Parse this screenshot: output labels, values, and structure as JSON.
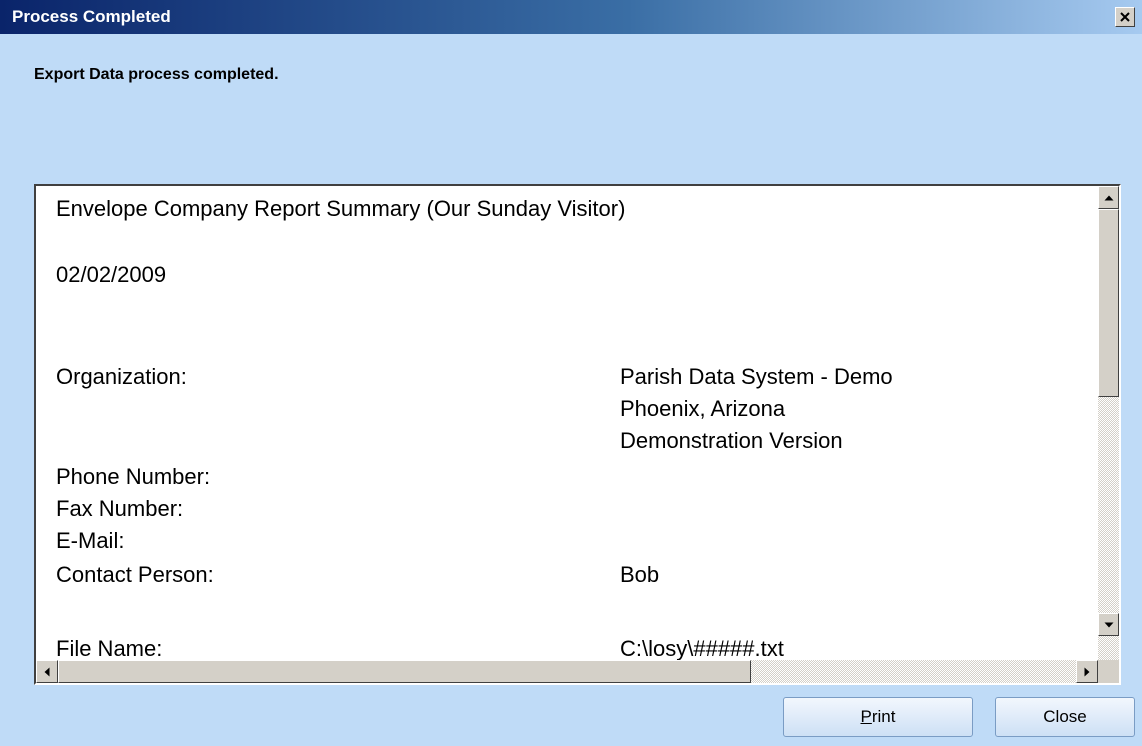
{
  "window": {
    "title": "Process Completed",
    "close_glyph": "X"
  },
  "message": "Export Data process completed.",
  "report": {
    "title": "Envelope Company Report Summary (Our Sunday Visitor)",
    "date": "02/02/2009",
    "organization_label": "Organization:",
    "organization_lines": [
      "Parish Data System - Demo",
      "Phoenix, Arizona",
      "Demonstration Version"
    ],
    "phone_label": "Phone Number:",
    "fax_label": "Fax Number:",
    "email_label": "E-Mail:",
    "contact_label": "Contact Person:",
    "contact_value": "Bob",
    "file_label": "File Name:",
    "file_value": "C:\\losy\\#####.txt"
  },
  "buttons": {
    "print_mnemonic": "P",
    "print_rest": "rint",
    "close_label": "Close"
  },
  "colors": {
    "dialog_background": "#bfdbf7",
    "titlebar_start": "#0a246a",
    "titlebar_end": "#a6caf0"
  },
  "icons": [
    "close-icon",
    "scroll-up-arrow-icon",
    "scroll-down-arrow-icon",
    "scroll-left-arrow-icon",
    "scroll-right-arrow-icon"
  ]
}
